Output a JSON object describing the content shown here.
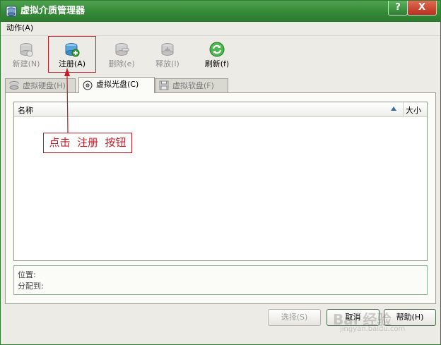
{
  "window": {
    "title": "虚拟介质管理器",
    "help_button": "?",
    "close_button": "X"
  },
  "menu": {
    "action": "动作(A)"
  },
  "toolbar": {
    "new": "新建(N)",
    "register": "注册(A)",
    "delete": "删除(e)",
    "release": "释放(l)",
    "refresh": "刷新(f)"
  },
  "tabs": {
    "hard_disk": "虚拟硬盘(H)",
    "cd": "虚拟光盘(C)",
    "floppy": "虚拟软盘(F)"
  },
  "list": {
    "col_name": "名称",
    "col_size": "大小"
  },
  "info": {
    "location": "位置:",
    "attached_to": "分配到:"
  },
  "buttons": {
    "select": "选择(S)",
    "cancel": "取消",
    "help": "帮助(H)"
  },
  "annotation": {
    "text": "点击  注册  按钮"
  },
  "watermark": {
    "text": "Bai 经验",
    "sub": "jingyan.baidu.com"
  },
  "colors": {
    "titlebar": "#358a37",
    "annotation": "#c0202a",
    "accent": "#2f7a33"
  }
}
